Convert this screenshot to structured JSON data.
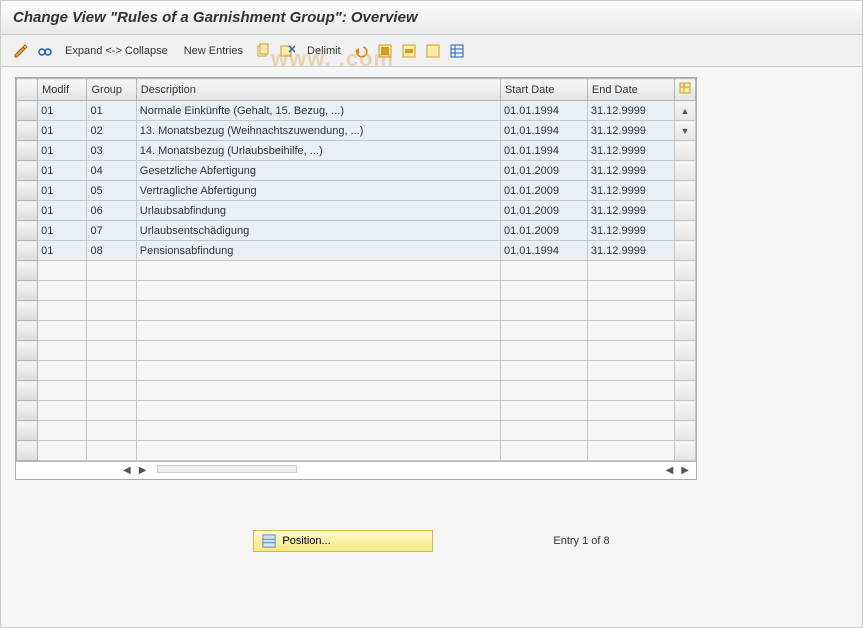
{
  "title": "Change View \"Rules of a Garnishment Group\": Overview",
  "toolbar": {
    "expand_label": "Expand <-> Collapse",
    "new_entries_label": "New Entries",
    "delimit_label": "Delimit"
  },
  "columns": {
    "modif": "Modif",
    "group": "Group",
    "description": "Description",
    "start": "Start Date",
    "end": "End Date"
  },
  "rows": [
    {
      "modif": "01",
      "group": "01",
      "desc": "Normale Einkünfte (Gehalt, 15. Bezug, ...)",
      "start": "01.01.1994",
      "end": "31.12.9999"
    },
    {
      "modif": "01",
      "group": "02",
      "desc": "13. Monatsbezug (Weihnachtszuwendung, ...)",
      "start": "01.01.1994",
      "end": "31.12.9999"
    },
    {
      "modif": "01",
      "group": "03",
      "desc": "14. Monatsbezug (Urlaubsbeihilfe, ...)",
      "start": "01.01.1994",
      "end": "31.12.9999"
    },
    {
      "modif": "01",
      "group": "04",
      "desc": "Gesetzliche Abfertigung",
      "start": "01.01.2009",
      "end": "31.12.9999"
    },
    {
      "modif": "01",
      "group": "05",
      "desc": "Vertragliche Abfertigung",
      "start": "01.01.2009",
      "end": "31.12.9999"
    },
    {
      "modif": "01",
      "group": "06",
      "desc": "Urlaubsabfindung",
      "start": "01.01.2009",
      "end": "31.12.9999"
    },
    {
      "modif": "01",
      "group": "07",
      "desc": "Urlaubsentschädigung",
      "start": "01.01.2009",
      "end": "31.12.9999"
    },
    {
      "modif": "01",
      "group": "08",
      "desc": "Pensionsabfindung",
      "start": "01.01.1994",
      "end": "31.12.9999"
    }
  ],
  "empty_row_count": 10,
  "footer": {
    "position_label": "Position...",
    "entry_label": "Entry 1 of 8"
  },
  "watermark": "www.         .com"
}
